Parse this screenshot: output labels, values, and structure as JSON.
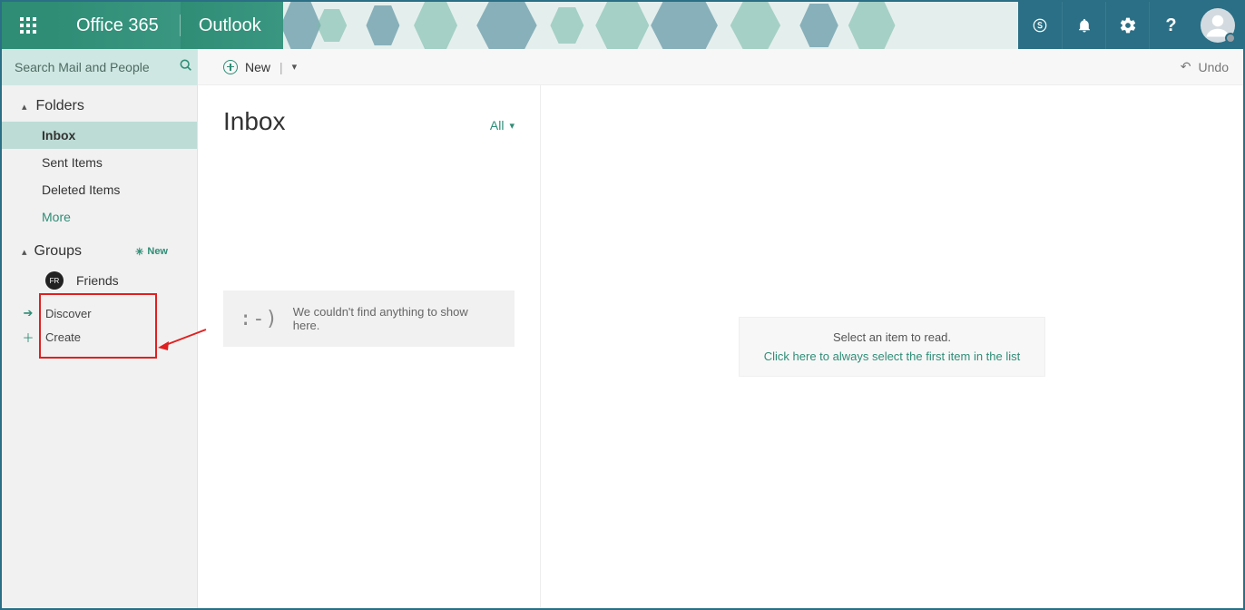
{
  "header": {
    "brand": "Office 365",
    "app": "Outlook",
    "icons": [
      "skype",
      "notifications",
      "settings",
      "help"
    ]
  },
  "search": {
    "placeholder": "Search Mail and People"
  },
  "nav": {
    "folders_label": "Folders",
    "folders": [
      {
        "label": "Inbox",
        "active": true
      },
      {
        "label": "Sent Items",
        "active": false
      },
      {
        "label": "Deleted Items",
        "active": false
      }
    ],
    "more_label": "More",
    "groups_label": "Groups",
    "groups_badge": "New",
    "groups": [
      {
        "avatar": "FR",
        "label": "Friends"
      }
    ],
    "actions": [
      {
        "icon": "arrow",
        "label": "Discover"
      },
      {
        "icon": "plus",
        "label": "Create"
      }
    ]
  },
  "cmdbar": {
    "new_label": "New",
    "undo_label": "Undo"
  },
  "list": {
    "title": "Inbox",
    "filter": "All",
    "empty_face": ":-)",
    "empty_line": "We couldn't find anything to show here."
  },
  "reading": {
    "line1": "Select an item to read.",
    "line2": "Click here to always select the first item in the list"
  }
}
